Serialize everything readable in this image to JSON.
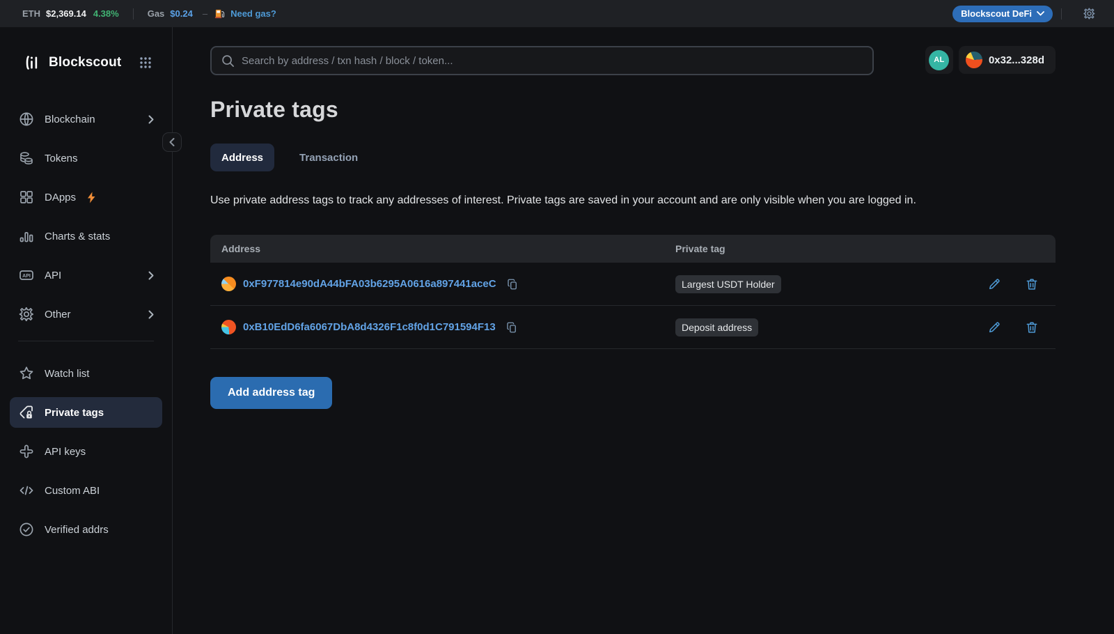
{
  "topbar": {
    "eth_label": "ETH",
    "eth_price": "$2,369.14",
    "eth_change": "4.38%",
    "gas_label": "Gas",
    "gas_price": "$0.24",
    "gas_dash": "–",
    "need_gas_link": "Need gas?",
    "defi_button_label": "Blockscout DeFi"
  },
  "sidebar": {
    "brand": "Blockscout",
    "items": [
      {
        "label": "Blockchain",
        "chevron": true
      },
      {
        "label": "Tokens"
      },
      {
        "label": "DApps"
      },
      {
        "label": "Charts & stats"
      },
      {
        "label": "API",
        "chevron": true
      },
      {
        "label": "Other",
        "chevron": true
      }
    ],
    "account_items": [
      {
        "label": "Watch list"
      },
      {
        "label": "Private tags",
        "active": true
      },
      {
        "label": "API keys"
      },
      {
        "label": "Custom ABI"
      },
      {
        "label": "Verified addrs"
      }
    ]
  },
  "search": {
    "placeholder": "Search by address / txn hash / block / token..."
  },
  "account": {
    "avatar_initials": "AL",
    "wallet_address_short": "0x32...328d"
  },
  "page": {
    "title": "Private tags",
    "tabs": [
      {
        "label": "Address",
        "active": true
      },
      {
        "label": "Transaction",
        "active": false
      }
    ],
    "description": "Use private address tags to track any addresses of interest. Private tags are saved in your account and are only visible when you are logged in.",
    "table": {
      "columns": {
        "address": "Address",
        "private_tag": "Private tag"
      },
      "rows": [
        {
          "address": "0xF977814e90dA44bFA03b6295A0616a897441aceC",
          "tag": "Largest USDT Holder"
        },
        {
          "address": "0xB10EdD6fa6067DbA8d4326F1c8f0d1C791594F13",
          "tag": "Deposit address"
        }
      ]
    },
    "add_button_label": "Add address tag"
  },
  "icons": {
    "api_badge_text": "API"
  },
  "colors": {
    "accent_blue": "#2b6cb0",
    "link_blue": "#62a3e6",
    "positive_green": "#41b373",
    "topbar_bg": "#1f2125",
    "page_bg": "#101114",
    "active_item_bg": "#232b3c",
    "badge_bg": "#2e3136",
    "avatar_teal": "#35b5a4"
  }
}
